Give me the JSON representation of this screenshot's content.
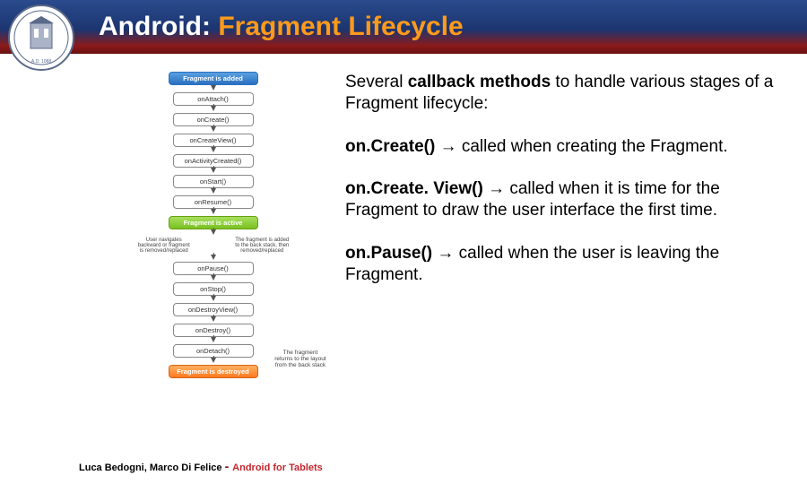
{
  "header": {
    "title_prefix": "Android: ",
    "title_main": "Fragment Lifecycle"
  },
  "diagram": {
    "nodes": [
      {
        "style": "blue",
        "label": "Fragment is\nadded"
      },
      {
        "style": "",
        "label": "onAttach()"
      },
      {
        "style": "",
        "label": "onCreate()"
      },
      {
        "style": "",
        "label": "onCreateView()"
      },
      {
        "style": "",
        "label": "onActivityCreated()"
      },
      {
        "style": "",
        "label": "onStart()"
      },
      {
        "style": "",
        "label": "onResume()"
      },
      {
        "style": "green",
        "label": "Fragment is\nactive"
      }
    ],
    "split_left": "User navigates backward or fragment is removed/replaced",
    "split_right": "The fragment is added to the back stack, then removed/replaced",
    "nodes2": [
      {
        "style": "",
        "label": "onPause()"
      },
      {
        "style": "",
        "label": "onStop()"
      },
      {
        "style": "",
        "label": "onDestroyView()"
      },
      {
        "style": "",
        "label": "onDestroy()"
      },
      {
        "style": "",
        "label": "onDetach()"
      },
      {
        "style": "orange",
        "label": "Fragment is\ndestroyed"
      }
    ],
    "return_note": "The fragment returns to the layout from the back stack"
  },
  "content": {
    "intro_pre": "Several ",
    "intro_bold": "callback methods",
    "intro_post": " to handle various stages of a Fragment lifecycle:",
    "p1_bold": "on.Create()",
    "p1_rest": " → called when creating the Fragment.",
    "p2_bold": "on.Create. View()",
    "p2_rest": " → called when it is time for the Fragment to draw the user interface the first time.",
    "p3_bold": "on.Pause()",
    "p3_rest": " → called when the user is leaving the Fragment."
  },
  "footer": {
    "authors": "Luca Bedogni, Marco Di Felice",
    "dash": " - ",
    "topic": "Android for Tablets"
  }
}
